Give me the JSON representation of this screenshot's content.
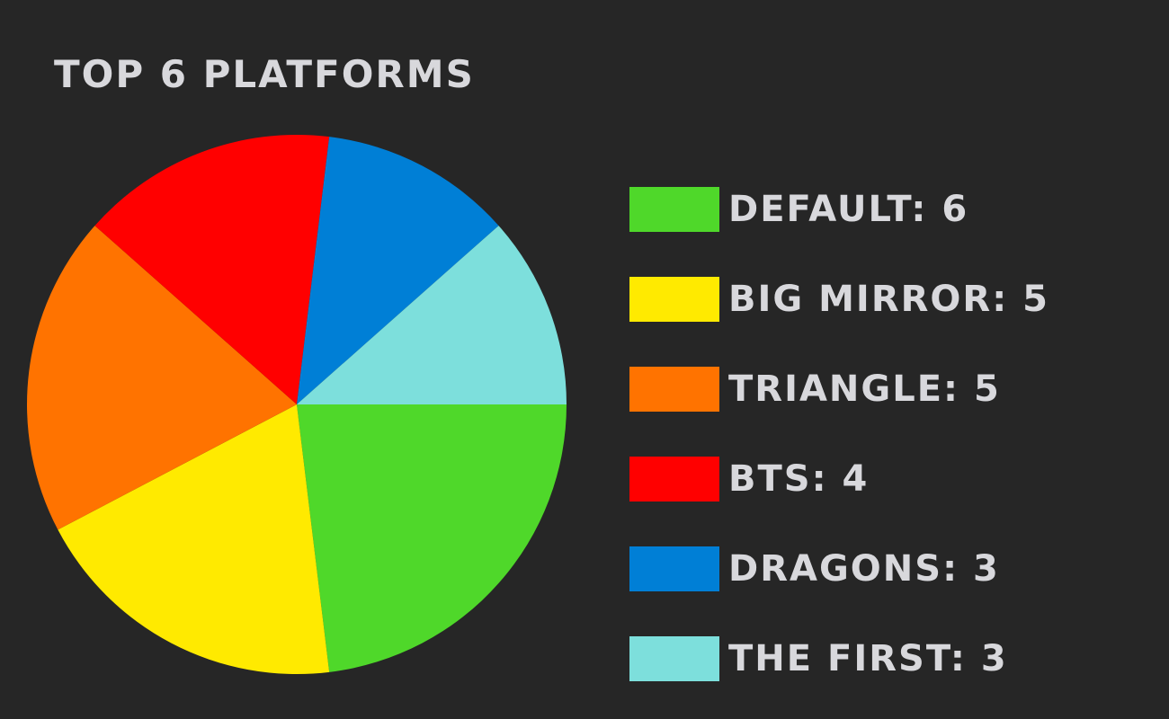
{
  "chart_data": {
    "type": "pie",
    "title": "Top 6 Platforms",
    "legend_position": "right",
    "slices": [
      {
        "label": "Default",
        "value": 6,
        "color": "#4fd82a"
      },
      {
        "label": "Big Mirror",
        "value": 5,
        "color": "#ffea00"
      },
      {
        "label": "Triangle",
        "value": 5,
        "color": "#ff7300"
      },
      {
        "label": "BTS",
        "value": 4,
        "color": "#ff0000"
      },
      {
        "label": "Dragons",
        "value": 3,
        "color": "#007fd6"
      },
      {
        "label": "The First",
        "value": 3,
        "color": "#7ddfdc"
      }
    ],
    "legend": [
      "DEFAULT: 6",
      "BIG MIRROR: 5",
      "TRIANGLE: 5",
      "BTS: 4",
      "DRAGONS: 3",
      "THE FIRST: 3"
    ]
  },
  "colors": {
    "background": "#262626",
    "text": "#d8d8dc"
  }
}
